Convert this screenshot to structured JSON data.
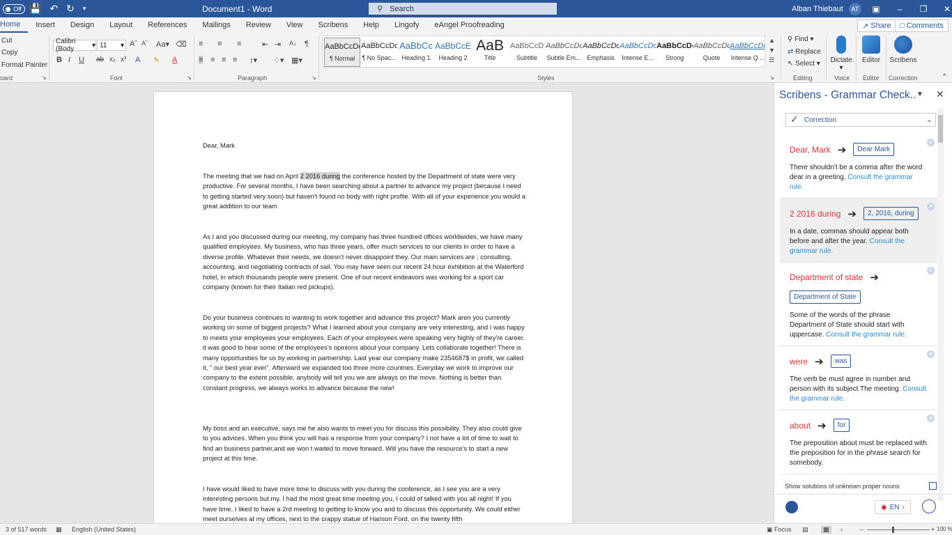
{
  "titlebar": {
    "autosave_state": "Off",
    "title": "Document1  -  Word",
    "search_placeholder": "Search",
    "user_name": "Alban Thiebaut",
    "user_initials": "AT"
  },
  "tabs": [
    "Home",
    "Insert",
    "Design",
    "Layout",
    "References",
    "Mailings",
    "Review",
    "View",
    "Scribens",
    "Help",
    "Lingofy",
    "eAngel Proofreading"
  ],
  "actions": {
    "share": "Share",
    "comments": "Comments"
  },
  "ribbon": {
    "clipboard": {
      "cut": "Cut",
      "copy": "Copy",
      "format_painter": "Format Painter",
      "label": "oard"
    },
    "font": {
      "name": "Calibri (Body",
      "size": "11",
      "label": "Font"
    },
    "paragraph": {
      "label": "Paragraph"
    },
    "styles": {
      "label": "Styles",
      "items": [
        {
          "preview": "AaBbCcDc",
          "name": "¶ Normal"
        },
        {
          "preview": "AaBbCcDc",
          "name": "¶ No Spac..."
        },
        {
          "preview": "AaBbCc",
          "name": "Heading 1"
        },
        {
          "preview": "AaBbCcE",
          "name": "Heading 2"
        },
        {
          "preview": "AaB",
          "name": "Title"
        },
        {
          "preview": "AaBbCcD",
          "name": "Subtitle"
        },
        {
          "preview": "AaBbCcDc",
          "name": "Subtle Em..."
        },
        {
          "preview": "AaBbCcDc",
          "name": "Emphasis"
        },
        {
          "preview": "AaBbCcDc",
          "name": "Intense E..."
        },
        {
          "preview": "AaBbCcDc",
          "name": "Strong"
        },
        {
          "preview": "AaBbCcDc",
          "name": "Quote"
        },
        {
          "preview": "AaBbCcDc",
          "name": "Intense Q..."
        }
      ]
    },
    "editing": {
      "find": "Find",
      "replace": "Replace",
      "select": "Select",
      "label": "Editing"
    },
    "voice": {
      "dictate": "Dictate",
      "label": "Voice"
    },
    "editor": {
      "editor": "Editor",
      "label": "Editor"
    },
    "correction": {
      "scribens": "Scribens",
      "label": "Correction"
    }
  },
  "document": {
    "greeting": "Dear, Mark",
    "p1": {
      "a": "The meeting that we had on April ",
      "hl": "2 2016 during",
      "b": " the conference hosted by the Department of state were very productive. For several months, I have been searching about a partner to advance my project (because I need to getting started very soon) but haven't found no body with right profile. With all of your experience you would a great addition to our team"
    },
    "p2": "As I and you discussed during our meeting, my company has three hundred offices worldwides, we have many qualified employees. My business, who has three years, offer much services to our clients in order to have a diverse profile. Whatever their needs, we doesn't never disappoint they. Our main services are ; consulting, accounting, and negotiating contracts of sail. You may have seen our recent 24 hour exhibition at the Waterford hotel, in which thousands people were present. One of our recent endeavors was working for a sport car company (known for their Italian red pickups).",
    "p3": "Do your business continues to wanting to work together and advance this project? Mark aren you currently working on some of biggest projects? What I learned about your company are very interesting, and I was happy to meets your employees your employees. Each of your employees were speaking very highly of they're career. it was good to hear some of the employees's opinions about your company. Lets collaborate together! There is many opportunities for us by working in partnership. Last year our company make 2354687$ in profit, we called it, \" our best year ever\". Afterward we expanded too three more countries. Everyday we work to improve our company to the extent possible, anybody will tell you we are always on the move.   Nothing is better than constant progress, we always works to advance because the new!",
    "p4": "My boss and an executive, says me he also wants to meet you for discuss this possibility. They also could give to you advices. When you think you will has a response from your company? I not have a lot of time to wait to find an business partner,and we won t waited to move forward. Will you have the resource's to start a new project at this time.",
    "p5": "I have would liked to have more time to discuss with you during the conference, as I see you are a very interesting persons but my. I had the most great time meeting you, I could of talked with you all night! If you have time, I liked to have a 2rd meeting to getting to know you and to discuss this opportunity. We could either meet ourselves at my offices, next to the crappy statue of Harison Ford, on the twenty fifth"
  },
  "pane": {
    "title": "Scribens - Grammar Check..",
    "mode": "Correction",
    "cards": [
      {
        "wrong": "Dear, Mark",
        "fix": "Dear Mark",
        "desc": "There shouldn't be a comma after the word dear in a greeting.",
        "link": "Consult the grammar rule."
      },
      {
        "wrong": "2 2016 during",
        "fix": "2, 2016, during",
        "desc": "In a date, commas should appear both before and after the year.",
        "link": "Consult the grammar rule."
      },
      {
        "wrong": "Department of state",
        "fix": "Department of State",
        "desc": "Some of the words of the phrase Department of State should start with uppercase.",
        "link": "Consult the grammar rule."
      },
      {
        "wrong": "were",
        "fix": "was",
        "desc": "The verb be must agree in number and person with its subject The meeting.",
        "link": "Consult the grammar rule."
      },
      {
        "wrong": "about",
        "fix": "for",
        "desc": "The preposition about must be replaced with the preposition for in the phrase search for somebody.",
        "link": ""
      }
    ],
    "show_unknown": "Show solutions of unknown proper nouns",
    "language": "EN"
  },
  "status": {
    "words": "3 of 517 words",
    "language": "English (United States)",
    "focus": "Focus",
    "zoom": "100 %"
  }
}
